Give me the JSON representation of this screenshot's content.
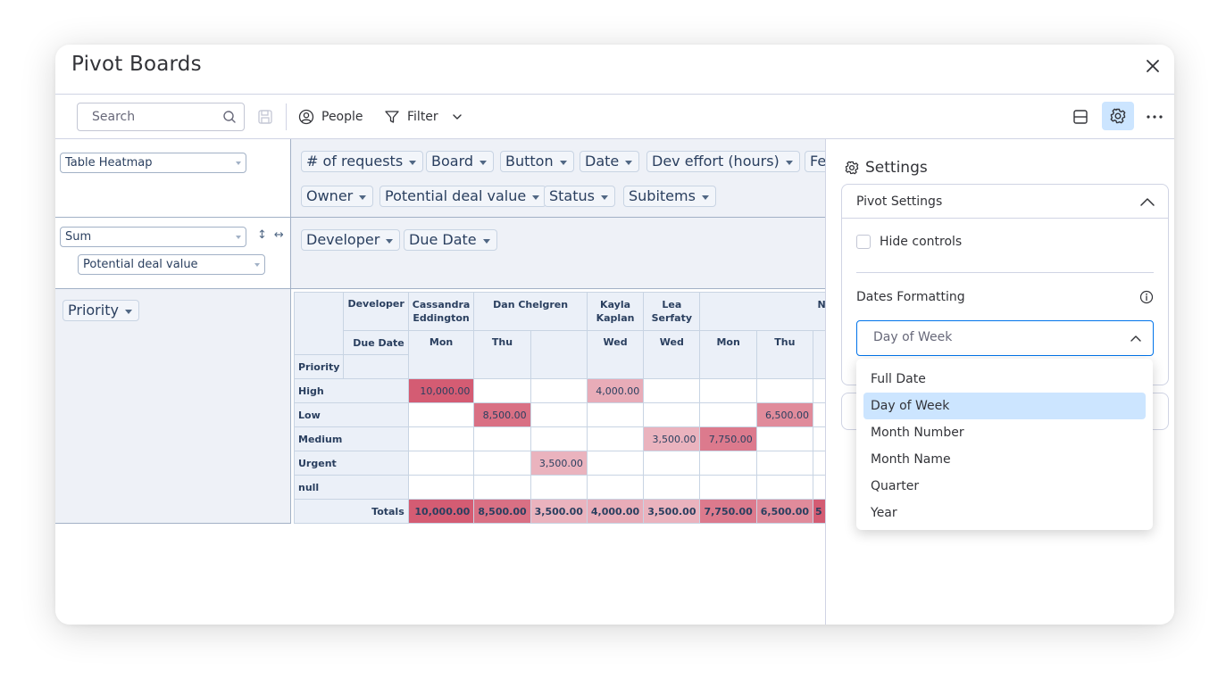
{
  "app": {
    "title": "Pivot Boards"
  },
  "toolbar": {
    "search_placeholder": "Search",
    "people_label": "People",
    "filter_label": "Filter"
  },
  "pivot": {
    "renderer": "Table Heatmap",
    "aggregator": "Sum",
    "aggregate_field": "Potential deal value",
    "axis_buttons": {
      "sort_vertical": "↕",
      "sort_horizontal": "↔"
    },
    "unused_fields": [
      "# of requests",
      "Board",
      "Button",
      "Date",
      "Dev effort (hours)",
      "Fe",
      "Owner",
      "Potential deal value",
      "Status",
      "Subitems"
    ],
    "col_fields": [
      "Developer",
      "Due Date"
    ],
    "row_fields": [
      "Priority"
    ],
    "table": {
      "col_field_labels": [
        "Developer",
        "Due Date"
      ],
      "row_field_label": "Priority",
      "developers": [
        "Cassandra Eddington",
        "Dan Chelgren",
        "Kayla Kaplan",
        "Lea Serfaty",
        "N"
      ],
      "due_dates": [
        "Mon",
        "Thu",
        "",
        "Wed",
        "Wed",
        "Mon",
        "Thu",
        ""
      ],
      "rows": [
        {
          "label": "High",
          "cells": [
            "10,000.00",
            "",
            "",
            "4,000.00",
            "",
            "",
            "",
            ""
          ]
        },
        {
          "label": "Low",
          "cells": [
            "",
            "8,500.00",
            "",
            "",
            "",
            "",
            "6,500.00",
            ""
          ]
        },
        {
          "label": "Medium",
          "cells": [
            "",
            "",
            "",
            "",
            "3,500.00",
            "7,750.00",
            "",
            ""
          ]
        },
        {
          "label": "Urgent",
          "cells": [
            "",
            "",
            "3,500.00",
            "",
            "",
            "",
            "",
            ""
          ]
        },
        {
          "label": "null",
          "cells": [
            "",
            "",
            "",
            "",
            "",
            "",
            "",
            ""
          ]
        }
      ],
      "totals_label": "Totals",
      "totals": [
        "10,000.00",
        "8,500.00",
        "3,500.00",
        "4,000.00",
        "3,500.00",
        "7,750.00",
        "6,500.00",
        "5"
      ]
    }
  },
  "settings": {
    "title": "Settings",
    "section_title": "Pivot Settings",
    "hide_controls_label": "Hide controls",
    "hide_controls_checked": false,
    "dates_formatting_label": "Dates Formatting",
    "dates_selected": "Day of Week",
    "dates_options": [
      "Full Date",
      "Day of Week",
      "Month Number",
      "Month Name",
      "Quarter",
      "Year"
    ]
  },
  "colors": {
    "accent": "#0073ea",
    "selected_bg": "#cce5ff",
    "heat_high": "#d45c73",
    "heat_low": "#eab3be"
  },
  "icons": {
    "close": "close-icon",
    "search": "search-icon",
    "save": "save-icon",
    "people": "person-circle-icon",
    "filter": "filter-funnel-icon",
    "layout": "split-layout-icon",
    "settings": "gear-icon",
    "more": "more-dots-icon",
    "info": "info-icon"
  }
}
